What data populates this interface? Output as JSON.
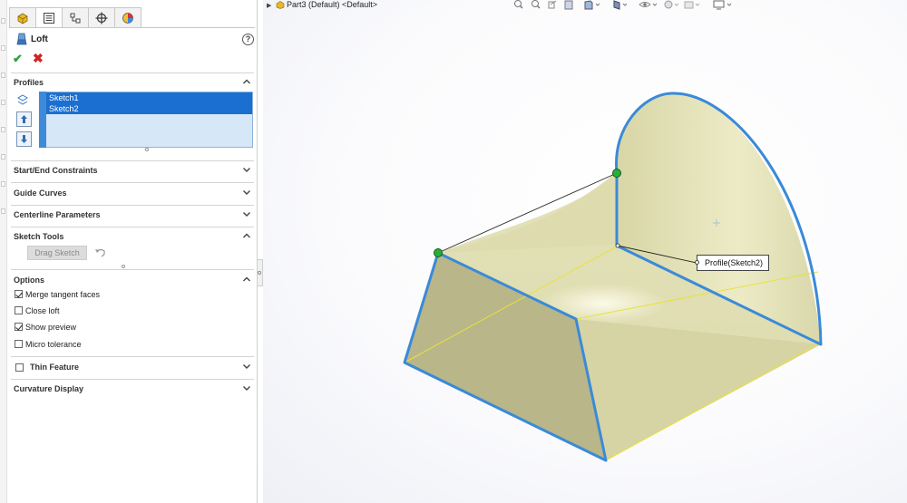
{
  "tree": {
    "node_label": "Part3 (Default) <Default>"
  },
  "feature": {
    "title": "Loft"
  },
  "profiles": {
    "heading": "Profiles",
    "items": [
      "Sketch1",
      "Sketch2"
    ]
  },
  "sections": {
    "start_end": "Start/End Constraints",
    "guide_curves": "Guide Curves",
    "centerline": "Centerline Parameters",
    "sketch_tools": "Sketch Tools",
    "options": "Options",
    "thin_feature": "Thin Feature",
    "curvature": "Curvature Display"
  },
  "sketch_tools": {
    "drag_label": "Drag Sketch"
  },
  "options": [
    {
      "label": "Merge tangent faces",
      "checked": true
    },
    {
      "label": "Close loft",
      "checked": false
    },
    {
      "label": "Show preview",
      "checked": true
    },
    {
      "label": "Micro tolerance",
      "checked": false
    }
  ],
  "thin_feature": {
    "checked": false
  },
  "viewport": {
    "callout_label": "Profile(Sketch2)"
  },
  "colors": {
    "selection_blue": "#1a6fd1",
    "edge_blue": "#3a8ad8",
    "surface": "#e4e2b8",
    "connector_green": "#27b035",
    "ok_green": "#2ea043",
    "cancel_red": "#d32222"
  },
  "icons": {
    "tabs": [
      "feature-manager-icon",
      "property-manager-icon",
      "configuration-manager-icon",
      "dimxpert-icon",
      "display-manager-icon"
    ],
    "title": "loft-icon",
    "help": "help-icon",
    "ok": "checkmark-icon",
    "cancel": "close-icon"
  }
}
